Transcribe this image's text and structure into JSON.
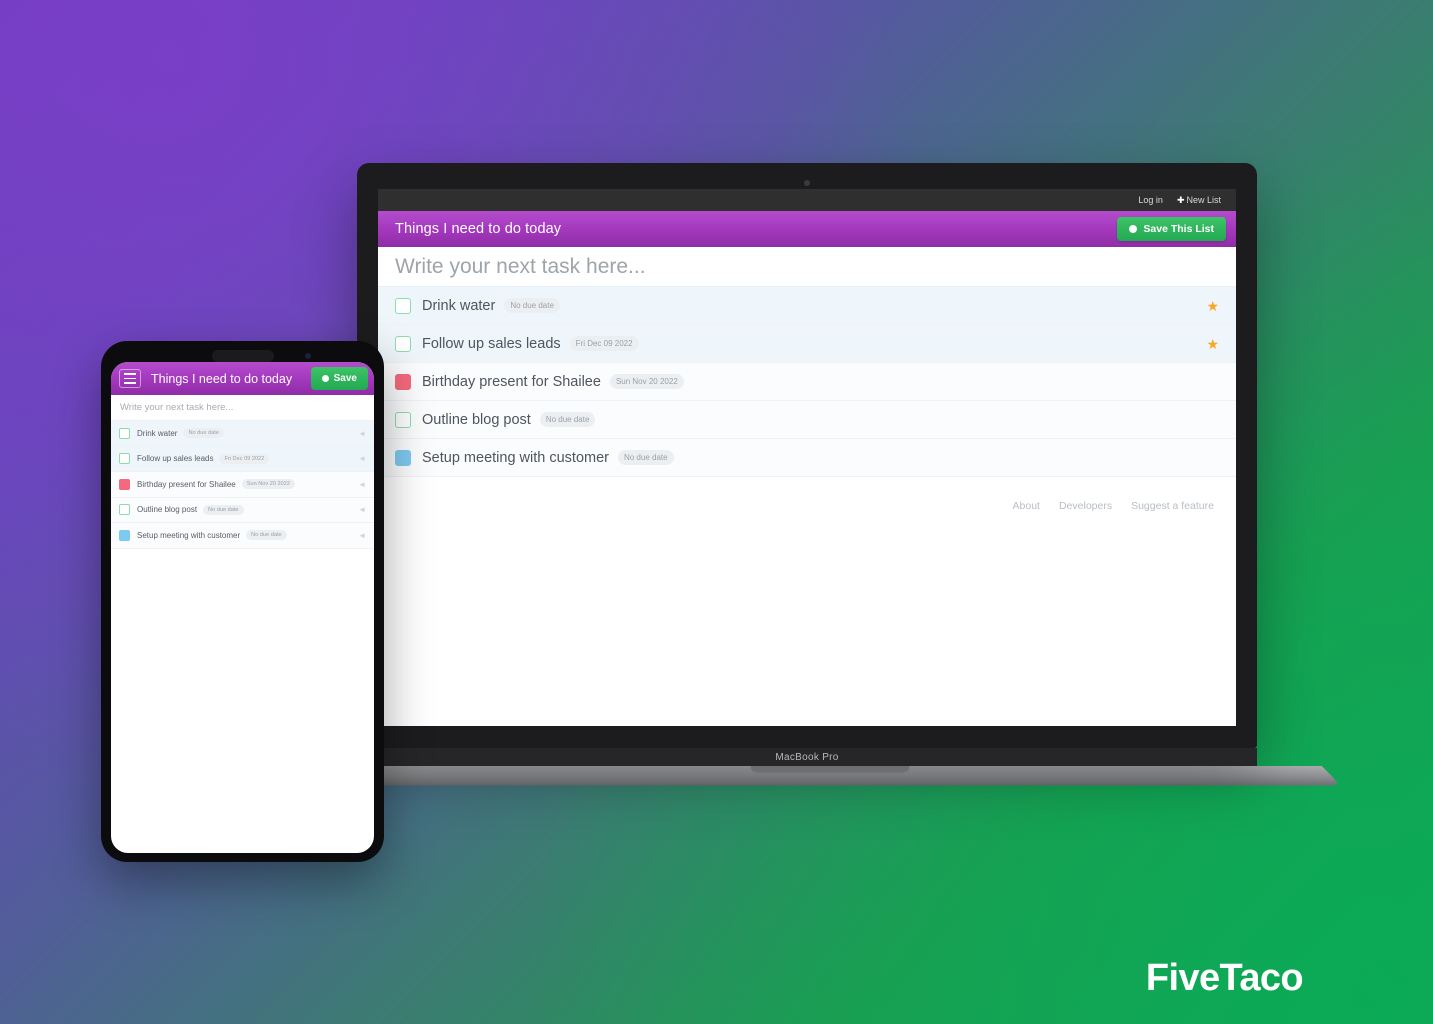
{
  "brand": {
    "logo": "FiveTaco"
  },
  "colors": {
    "bg_purple": "#6349ba",
    "bg_green": "#16a75c",
    "header_purple": "#a438bd",
    "save_green": "#22a952",
    "star_amber": "#f9a825",
    "swatch_pink": "#f4697e",
    "swatch_blue": "#7ec9ef",
    "swatch_green_border": "#8fdcab"
  },
  "devices": {
    "laptop": {
      "model_label": "MacBook Pro",
      "camera_icon": "camera-dot"
    },
    "phone": {
      "notch_icon": "speaker-pill",
      "camera_icon": "camera-dot"
    }
  },
  "topbar": {
    "login_label": "Log in",
    "new_list_label": "New List",
    "new_list_icon": "plus-icon"
  },
  "app_header": {
    "title": "Things I need to do today",
    "save_label": "Save This List",
    "save_icon": "circle-dot-icon"
  },
  "mobile_header": {
    "menu_icon": "hamburger-menu-icon",
    "title": "Things I need to do today",
    "save_label": "Save",
    "save_icon": "circle-dot-icon"
  },
  "new_task": {
    "placeholder": "Write your next task here...",
    "value": ""
  },
  "tasks": [
    {
      "label": "Drink water",
      "due": "No due date",
      "swatch": "empty",
      "starred": true,
      "row_tint": true
    },
    {
      "label": "Follow up sales leads",
      "due": "Fri Dec 09 2022",
      "swatch": "empty",
      "starred": true,
      "row_tint": true
    },
    {
      "label": "Birthday present for Shailee",
      "due": "Sun Nov 20 2022",
      "swatch": "pink",
      "starred": false,
      "row_tint": false
    },
    {
      "label": "Outline blog post",
      "due": "No due date",
      "swatch": "empty",
      "starred": false,
      "row_tint": false
    },
    {
      "label": "Setup meeting with customer",
      "due": "No due date",
      "swatch": "blue",
      "starred": false,
      "row_tint": false
    }
  ],
  "footer": {
    "links": [
      {
        "label": "About"
      },
      {
        "label": "Developers"
      },
      {
        "label": "Suggest a feature"
      }
    ]
  },
  "icons": {
    "star": "★",
    "chevron_left": "◄",
    "plus": "✚"
  }
}
